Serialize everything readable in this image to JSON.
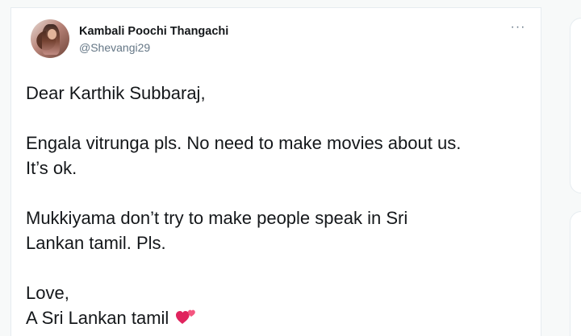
{
  "tweet": {
    "author": {
      "display_name": "Kambali Poochi Thangachi",
      "handle": "@Shevangi29"
    },
    "more_icon": "ellipsis-icon",
    "more_label": "···",
    "body": {
      "greeting": "Dear Karthik Subbaraj,",
      "para1_line1": "Engala vitrunga pls. No need to make movies about us.",
      "para1_line2": "It’s ok.",
      "para2_line1": "Mukkiyama don’t try to make people speak in Sri",
      "para2_line2": "Lankan tamil. Pls.",
      "signoff_line1": "Love,",
      "signoff_line2": "A Sri Lankan tamil",
      "emoji": "two-hearts-icon"
    }
  },
  "colors": {
    "text_primary": "#14171a",
    "text_secondary": "#657786",
    "heart_pink": "#e0245e",
    "background": "#f7f9f9",
    "card": "#ffffff"
  }
}
